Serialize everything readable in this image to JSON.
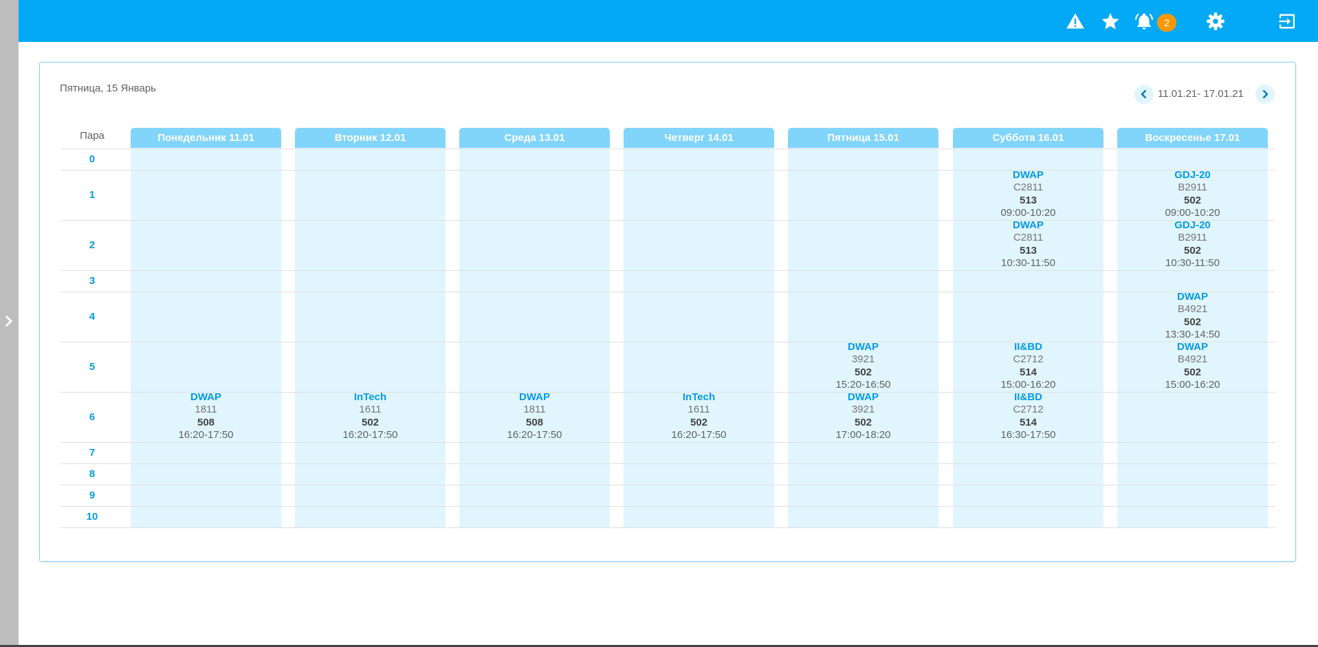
{
  "header": {
    "icons": [
      "warning-icon",
      "star-icon",
      "bell-icon",
      "gear-icon",
      "logout-icon"
    ],
    "notification_count": "2",
    "accent": "#03a9f4",
    "badge_color": "#ff9800"
  },
  "schedule": {
    "current_date": "Пятница, 15 Январь",
    "week_range": "11.01.21- 17.01.21",
    "pair_header": "Пара",
    "pairs": [
      "0",
      "1",
      "2",
      "3",
      "4",
      "5",
      "6",
      "7",
      "8",
      "9",
      "10"
    ],
    "days": [
      {
        "label": "Понедельник 11.01",
        "lessons": [
          {
            "pair": "6",
            "subject": "DWAP",
            "group": "1811",
            "room": "508",
            "time": "16:20-17:50"
          }
        ]
      },
      {
        "label": "Вторник 12.01",
        "lessons": [
          {
            "pair": "6",
            "subject": "InTech",
            "group": "1611",
            "room": "502",
            "time": "16:20-17:50"
          }
        ]
      },
      {
        "label": "Среда 13.01",
        "lessons": [
          {
            "pair": "6",
            "subject": "DWAP",
            "group": "1811",
            "room": "508",
            "time": "16:20-17:50"
          }
        ]
      },
      {
        "label": "Четверг 14.01",
        "lessons": [
          {
            "pair": "6",
            "subject": "InTech",
            "group": "1611",
            "room": "502",
            "time": "16:20-17:50"
          }
        ]
      },
      {
        "label": "Пятница 15.01",
        "lessons": [
          {
            "pair": "5",
            "subject": "DWAP",
            "group": "3921",
            "room": "502",
            "time": "15:20-16:50"
          },
          {
            "pair": "6",
            "subject": "DWAP",
            "group": "3921",
            "room": "502",
            "time": "17:00-18:20"
          }
        ]
      },
      {
        "label": "Суббота 16.01",
        "lessons": [
          {
            "pair": "1",
            "subject": "DWAP",
            "group": "C2811",
            "room": "513",
            "time": "09:00-10:20"
          },
          {
            "pair": "2",
            "subject": "DWAP",
            "group": "C2811",
            "room": "513",
            "time": "10:30-11:50"
          },
          {
            "pair": "5",
            "subject": "II&BD",
            "group": "C2712",
            "room": "514",
            "time": "15:00-16:20"
          },
          {
            "pair": "6",
            "subject": "II&BD",
            "group": "C2712",
            "room": "514",
            "time": "16:30-17:50"
          }
        ]
      },
      {
        "label": "Воскресенье 17.01",
        "lessons": [
          {
            "pair": "1",
            "subject": "GDJ-20",
            "group": "B2911",
            "room": "502",
            "time": "09:00-10:20"
          },
          {
            "pair": "2",
            "subject": "GDJ-20",
            "group": "B2911",
            "room": "502",
            "time": "10:30-11:50"
          },
          {
            "pair": "4",
            "subject": "DWAP",
            "group": "B4921",
            "room": "502",
            "time": "13:30-14:50"
          },
          {
            "pair": "5",
            "subject": "DWAP",
            "group": "B4921",
            "room": "502",
            "time": "15:00-16:20"
          }
        ]
      }
    ]
  }
}
